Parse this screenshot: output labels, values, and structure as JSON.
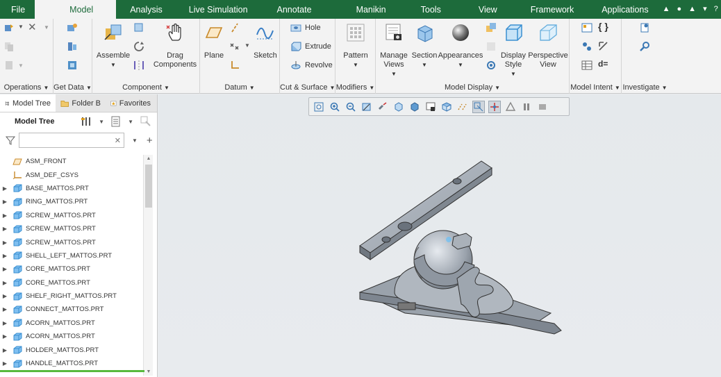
{
  "menubar": {
    "tabs": [
      "File",
      "Model",
      "Analysis",
      "Live Simulation",
      "Annotate",
      "Manikin",
      "Tools",
      "View",
      "Framework",
      "Applications"
    ],
    "active": "Model"
  },
  "ribbon": {
    "groups": {
      "operations": "Operations",
      "get_data": "Get Data",
      "component": "Component",
      "datum": "Datum",
      "cut_surface": "Cut & Surface",
      "modifiers": "Modifiers",
      "model_display": "Model Display",
      "model_intent": "Model Intent",
      "investigate": "Investigate"
    },
    "buttons": {
      "assemble": "Assemble",
      "drag_components_1": "Drag",
      "drag_components_2": "Components",
      "plane": "Plane",
      "sketch": "Sketch",
      "hole": "Hole",
      "extrude": "Extrude",
      "revolve": "Revolve",
      "pattern": "Pattern",
      "manage_views_1": "Manage",
      "manage_views_2": "Views",
      "section": "Section",
      "appearances": "Appearances",
      "display_style_1": "Display",
      "display_style_2": "Style",
      "perspective_view_1": "Perspective",
      "perspective_view_2": "View"
    }
  },
  "panel": {
    "tabs": [
      "Model Tree",
      "Folder B",
      "Favorites"
    ],
    "tree_title": "Model Tree",
    "search": {
      "value": "",
      "placeholder": ""
    }
  },
  "tree_items": [
    {
      "label": "ASM_FRONT",
      "icon": "datum-plane-icon",
      "expandable": false
    },
    {
      "label": "ASM_DEF_CSYS",
      "icon": "csys-icon",
      "expandable": false
    },
    {
      "label": "BASE_MATTOS.PRT",
      "icon": "part-icon",
      "expandable": true
    },
    {
      "label": "RING_MATTOS.PRT",
      "icon": "part-icon",
      "expandable": true
    },
    {
      "label": "SCREW_MATTOS.PRT",
      "icon": "part-icon",
      "expandable": true
    },
    {
      "label": "SCREW_MATTOS.PRT",
      "icon": "part-icon",
      "expandable": true
    },
    {
      "label": "SCREW_MATTOS.PRT",
      "icon": "part-icon",
      "expandable": true
    },
    {
      "label": "SHELL_LEFT_MATTOS.PRT",
      "icon": "part-icon",
      "expandable": true
    },
    {
      "label": "CORE_MATTOS.PRT",
      "icon": "part-icon",
      "expandable": true
    },
    {
      "label": "CORE_MATTOS.PRT",
      "icon": "part-icon",
      "expandable": true
    },
    {
      "label": "SHELF_RIGHT_MATTOS.PRT",
      "icon": "part-icon",
      "expandable": true
    },
    {
      "label": "CONNECT_MATTOS.PRT",
      "icon": "part-icon",
      "expandable": true
    },
    {
      "label": "ACORN_MATTOS.PRT",
      "icon": "part-icon",
      "expandable": true
    },
    {
      "label": "ACORN_MATTOS.PRT",
      "icon": "part-icon",
      "expandable": true
    },
    {
      "label": "HOLDER_MATTOS.PRT",
      "icon": "part-icon",
      "expandable": true
    },
    {
      "label": "HANDLE_MATTOS.PRT",
      "icon": "part-icon",
      "expandable": true
    }
  ],
  "colors": {
    "menubar": "#1d6b3b",
    "accent_green": "#58b93d",
    "part_icon": "#3a8fd1",
    "model": "#a9b0b9"
  }
}
